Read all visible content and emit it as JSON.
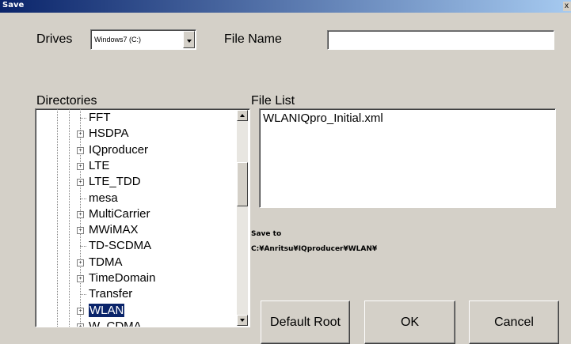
{
  "window": {
    "title": "Save",
    "close_glyph": "x"
  },
  "drives": {
    "label": "Drives",
    "selected": "Windows7 (C:)"
  },
  "file_name": {
    "label": "File Name",
    "value": ""
  },
  "directories": {
    "label": "Directories",
    "items": [
      {
        "label": "FFT",
        "expandable": false,
        "selected": false
      },
      {
        "label": "HSDPA",
        "expandable": true,
        "selected": false
      },
      {
        "label": "IQproducer",
        "expandable": true,
        "selected": false
      },
      {
        "label": "LTE",
        "expandable": true,
        "selected": false
      },
      {
        "label": "LTE_TDD",
        "expandable": true,
        "selected": false
      },
      {
        "label": "mesa",
        "expandable": false,
        "selected": false
      },
      {
        "label": "MultiCarrier",
        "expandable": true,
        "selected": false
      },
      {
        "label": "MWiMAX",
        "expandable": true,
        "selected": false
      },
      {
        "label": "TD-SCDMA",
        "expandable": false,
        "selected": false
      },
      {
        "label": "TDMA",
        "expandable": true,
        "selected": false
      },
      {
        "label": "TimeDomain",
        "expandable": true,
        "selected": false
      },
      {
        "label": "Transfer",
        "expandable": false,
        "selected": false
      },
      {
        "label": "WLAN",
        "expandable": true,
        "selected": true
      },
      {
        "label": "W_CDMA",
        "expandable": true,
        "selected": false
      }
    ],
    "expander_glyph": "+"
  },
  "file_list": {
    "label": "File List",
    "items": [
      "WLANIQpro_Initial.xml"
    ]
  },
  "save_to": {
    "label": "Save to",
    "path": "C:¥Anritsu¥IQproducer¥WLAN¥"
  },
  "buttons": {
    "default_root": "Default Root",
    "ok": "OK",
    "cancel": "Cancel"
  },
  "colors": {
    "face": "#d4d0c8",
    "title_bar": "#0a246a",
    "selection": "#0a246a"
  }
}
